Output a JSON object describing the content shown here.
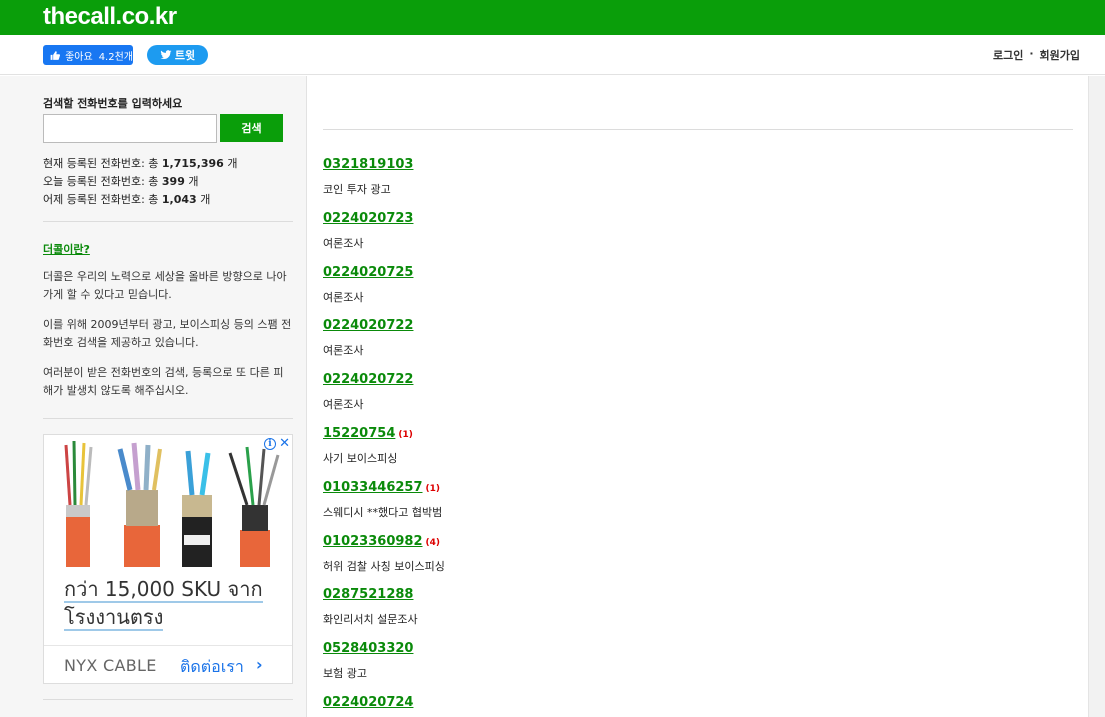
{
  "site": {
    "logo": "thecall.co.kr"
  },
  "social": {
    "like_label": "좋아요",
    "like_count": "4.2천개",
    "tweet_label": "트윗"
  },
  "auth": {
    "login": "로그인",
    "separator": "·",
    "signup": "회원가입"
  },
  "search": {
    "label": "검색할 전화번호를 입력하세요",
    "value": "",
    "button": "검색"
  },
  "stats": {
    "total_prefix": "현재 등록된 전화번호: 총 ",
    "total": "1,715,396",
    "total_suffix": " 개",
    "today_prefix": "오늘 등록된 전화번호: 총 ",
    "today": "399",
    "today_suffix": " 개",
    "yesterday_prefix": "어제 등록된 전화번호: 총 ",
    "yesterday": "1,043",
    "yesterday_suffix": " 개"
  },
  "about": {
    "link": "더콜이란?",
    "p1": "더콜은 우리의 노력으로 세상을 올바른 방향으로 나아가게 할 수 있다고 믿습니다.",
    "p2": "이를 위해 2009년부터 광고, 보이스피싱 등의 스팸 전화번호 검색을 제공하고 있습니다.",
    "p3": "여러분이 받은 전화번호의 검색, 등록으로 또 다른 피해가 발생치 않도록 해주십시오."
  },
  "ad": {
    "headline_1": "กว่า 15,000 SKU จาก",
    "headline_2": "โรงงานตรง",
    "brand": "NYX CABLE",
    "cta": "ติดต่อเรา",
    "chevron": "›",
    "info": "i",
    "close": "✕"
  },
  "entries": [
    {
      "number": "0321819103",
      "count": "",
      "desc": "코인 투자 광고"
    },
    {
      "number": "0224020723",
      "count": "",
      "desc": "여론조사"
    },
    {
      "number": "0224020725",
      "count": "",
      "desc": "여론조사"
    },
    {
      "number": "0224020722",
      "count": "",
      "desc": "여론조사"
    },
    {
      "number": "0224020722",
      "count": "",
      "desc": "여론조사"
    },
    {
      "number": "15220754",
      "count": "(1)",
      "desc": "사기 보이스피싱"
    },
    {
      "number": "01033446257",
      "count": "(1)",
      "desc": "스웨디시 **했다고 협박범"
    },
    {
      "number": "01023360982",
      "count": "(4)",
      "desc": "허위 검찰 사칭 보이스피싱"
    },
    {
      "number": "0287521288",
      "count": "",
      "desc": "화인리서치 설문조사"
    },
    {
      "number": "0528403320",
      "count": "",
      "desc": "보험 광고"
    },
    {
      "number": "0224020724",
      "count": "",
      "desc": "여론조사"
    }
  ],
  "colors": {
    "brand_green": "#0a9e0a",
    "link_green": "#0a8a0a",
    "count_red": "#dd0000",
    "facebook": "#1877f2",
    "twitter": "#1d9bf0"
  }
}
